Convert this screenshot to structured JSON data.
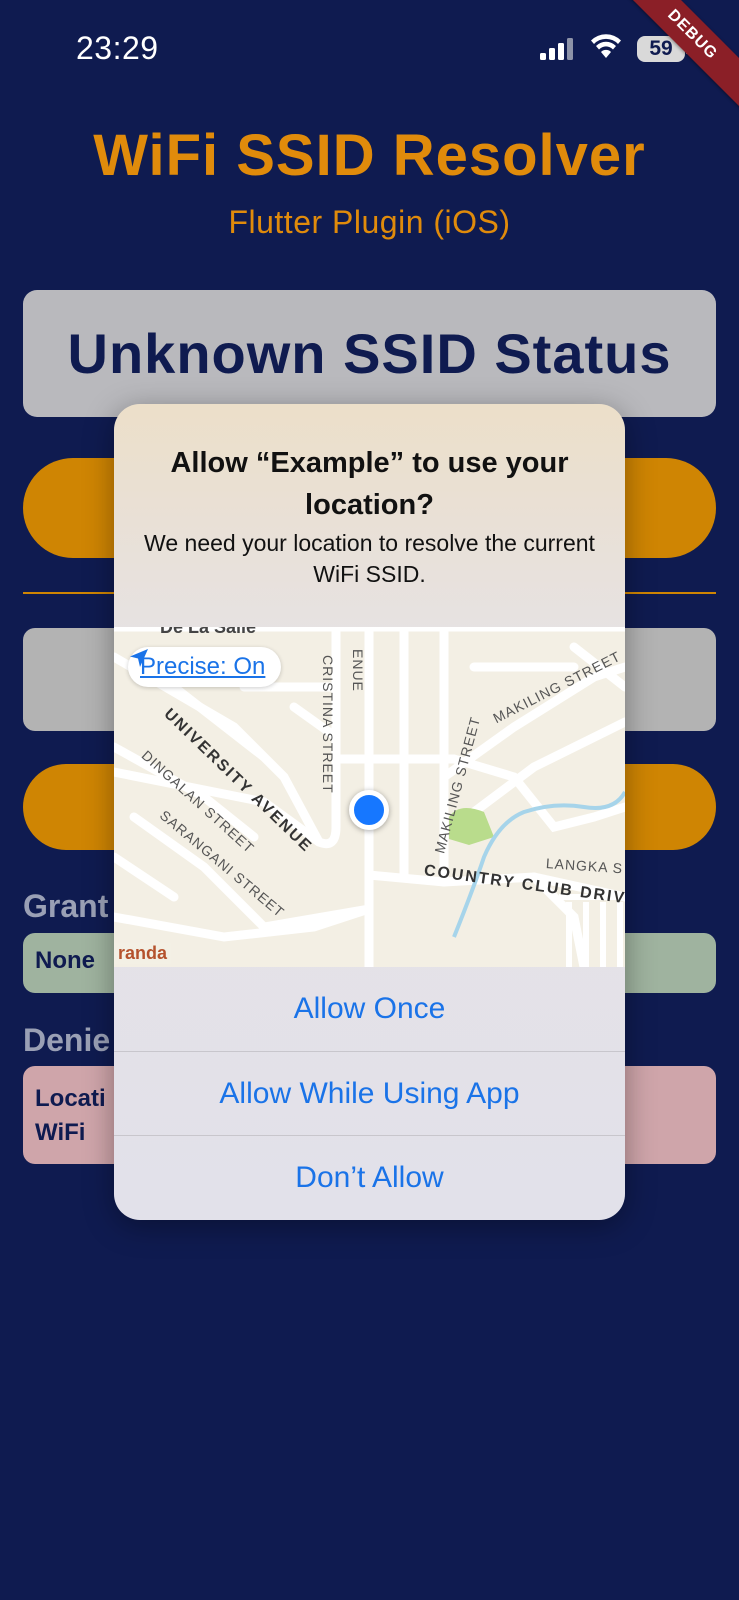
{
  "status_bar": {
    "time": "23:29",
    "battery": "59",
    "debug_banner": "DEBUG"
  },
  "app": {
    "title": "WiFi SSID Resolver",
    "subtitle": "Flutter Plugin (iOS)",
    "ssid_status": "Unknown SSID Status",
    "granted_label": "Grant",
    "granted_value": "None",
    "denied_label": "Denie",
    "denied_value": "Locati WiFi"
  },
  "dialog": {
    "title": "Allow “Example” to use your location?",
    "message": "We need your location to resolve the current WiFi SSID.",
    "precise_label": "Precise: On",
    "map_labels": {
      "place": "De La Salle",
      "cut_label": "randa",
      "avenue_top": "ENUE",
      "cristina": "CRISTINA STREET",
      "university": "UNIVERSITY AVENUE",
      "dingalan": "DINGALAN STREET",
      "sarangani": "SARANGANI STREET",
      "makiling_1": "MAKILING STREET",
      "makiling_2": "MAKILING STREET",
      "country_club": "COUNTRY CLUB DRIV",
      "langka": "LANGKA S"
    },
    "actions": {
      "allow_once": "Allow Once",
      "allow_while_using": "Allow While Using App",
      "dont_allow": "Don’t Allow"
    }
  },
  "colors": {
    "background": "#0f1b50",
    "accent": "#e08b0b",
    "link": "#1a73e8"
  }
}
